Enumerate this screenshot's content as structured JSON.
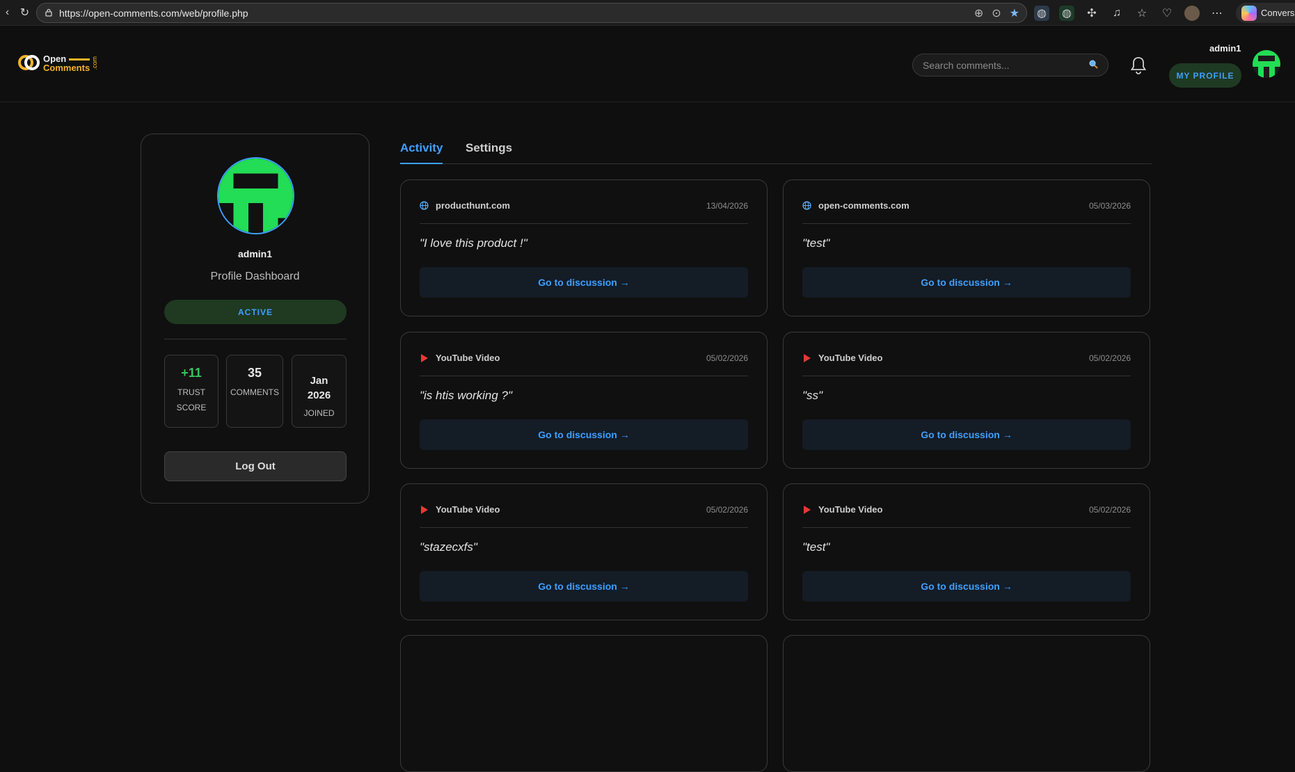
{
  "browser": {
    "url": "https://open-comments.com/web/profile.php",
    "copilot_label": "Conversa"
  },
  "header": {
    "logo_top": "Open",
    "logo_bottom": "Comments",
    "logo_suffix": ".com",
    "search_placeholder": "Search comments...",
    "username": "admin1",
    "my_profile_label": "MY PROFILE"
  },
  "profile": {
    "name": "admin1",
    "subtitle": "Profile Dashboard",
    "status": "ACTIVE",
    "stats": {
      "trust_value": "+11",
      "trust_label_1": "TRUST",
      "trust_label_2": "SCORE",
      "comments_value": "35",
      "comments_label": "COMMENTS",
      "joined_month": "Jan",
      "joined_year": "2026",
      "joined_label": "JOINED"
    },
    "logout_label": "Log Out"
  },
  "tabs": [
    {
      "label": "Activity"
    },
    {
      "label": "Settings"
    }
  ],
  "activity": [
    {
      "source": "producthunt.com",
      "source_type": "globe-icon",
      "date": "13/04/2026",
      "quote": "\"I love this product !\"",
      "button": "Go to discussion →"
    },
    {
      "source": "open-comments.com",
      "source_type": "globe-icon",
      "date": "05/03/2026",
      "quote": "\"test\"",
      "button": "Go to discussion →"
    },
    {
      "source": "YouTube Video",
      "source_type": "play-icon",
      "date": "05/02/2026",
      "quote": "\"is htis working ?\"",
      "button": "Go to discussion →"
    },
    {
      "source": "YouTube Video",
      "source_type": "play-icon",
      "date": "05/02/2026",
      "quote": "\"ss\"",
      "button": "Go to discussion →"
    },
    {
      "source": "YouTube Video",
      "source_type": "play-icon",
      "date": "05/02/2026",
      "quote": "\"stazecxfs\"",
      "button": "Go to discussion →"
    },
    {
      "source": "YouTube Video",
      "source_type": "play-icon",
      "date": "05/02/2026",
      "quote": "\"test\"",
      "button": "Go to discussion →"
    }
  ],
  "colors": {
    "accent_blue": "#3ea0ff",
    "brand_yellow": "#f5b32a",
    "avatar_green": "#22dd55",
    "trust_green": "#39c45f",
    "youtube_red": "#e53935"
  }
}
